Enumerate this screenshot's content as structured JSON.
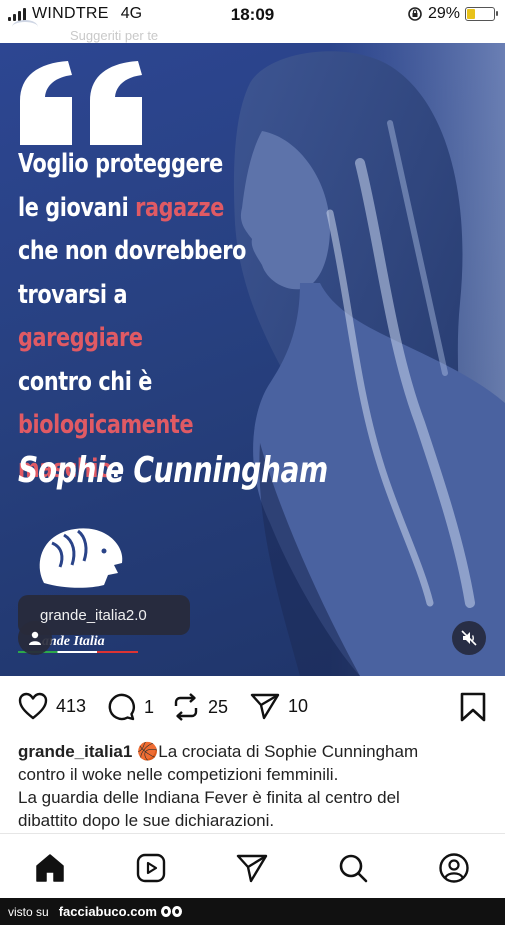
{
  "status_bar": {
    "carrier": "WINDTRE",
    "network": "4G",
    "time": "18:09",
    "battery": "29%",
    "battery_level": 0.29,
    "battery_color": "#e8c21a"
  },
  "header": {
    "suggestion_text": "Suggeriti per te"
  },
  "post": {
    "quote_lines": [
      {
        "parts": [
          {
            "text": "Voglio proteggere",
            "highlight": false
          }
        ]
      },
      {
        "parts": [
          {
            "text": "le giovani ",
            "highlight": false
          },
          {
            "text": "ragazze",
            "highlight": true
          }
        ]
      },
      {
        "parts": [
          {
            "text": "che non dovrebbero",
            "highlight": false
          }
        ]
      },
      {
        "parts": [
          {
            "text": "trovarsi a ",
            "highlight": false
          },
          {
            "text": "gareggiare",
            "highlight": true
          }
        ]
      },
      {
        "parts": [
          {
            "text": "contro chi è",
            "highlight": false
          }
        ]
      },
      {
        "parts": [
          {
            "text": "biologicamente",
            "highlight": true
          }
        ]
      },
      {
        "parts": [
          {
            "text": "maschio",
            "highlight": true
          },
          {
            "text": ".",
            "highlight": false
          }
        ]
      }
    ],
    "author": "Sophie Cunningham",
    "brand_text": "ande Italia",
    "tagged_user": "grande_italia2.0",
    "highlight_color": "#e05a64",
    "background_color": "#2a4388"
  },
  "actions": {
    "likes": "413",
    "comments": "1",
    "reposts": "25",
    "shares": "10"
  },
  "caption": {
    "username": "grande_italia1",
    "emoji": "🏀",
    "line1": "La crociata di Sophie Cunningham",
    "line2": "contro il woke nelle competizioni femminili.",
    "line3": "La guardia delle Indiana Fever è finita al centro del",
    "line4": "dibattito dopo le sue dichiarazioni."
  },
  "bottom_nav": [
    "home-icon",
    "reels-icon",
    "send-icon",
    "search-icon",
    "profile-icon"
  ],
  "footer": {
    "prefix": "visto su",
    "brand": "facciabuco.com"
  }
}
